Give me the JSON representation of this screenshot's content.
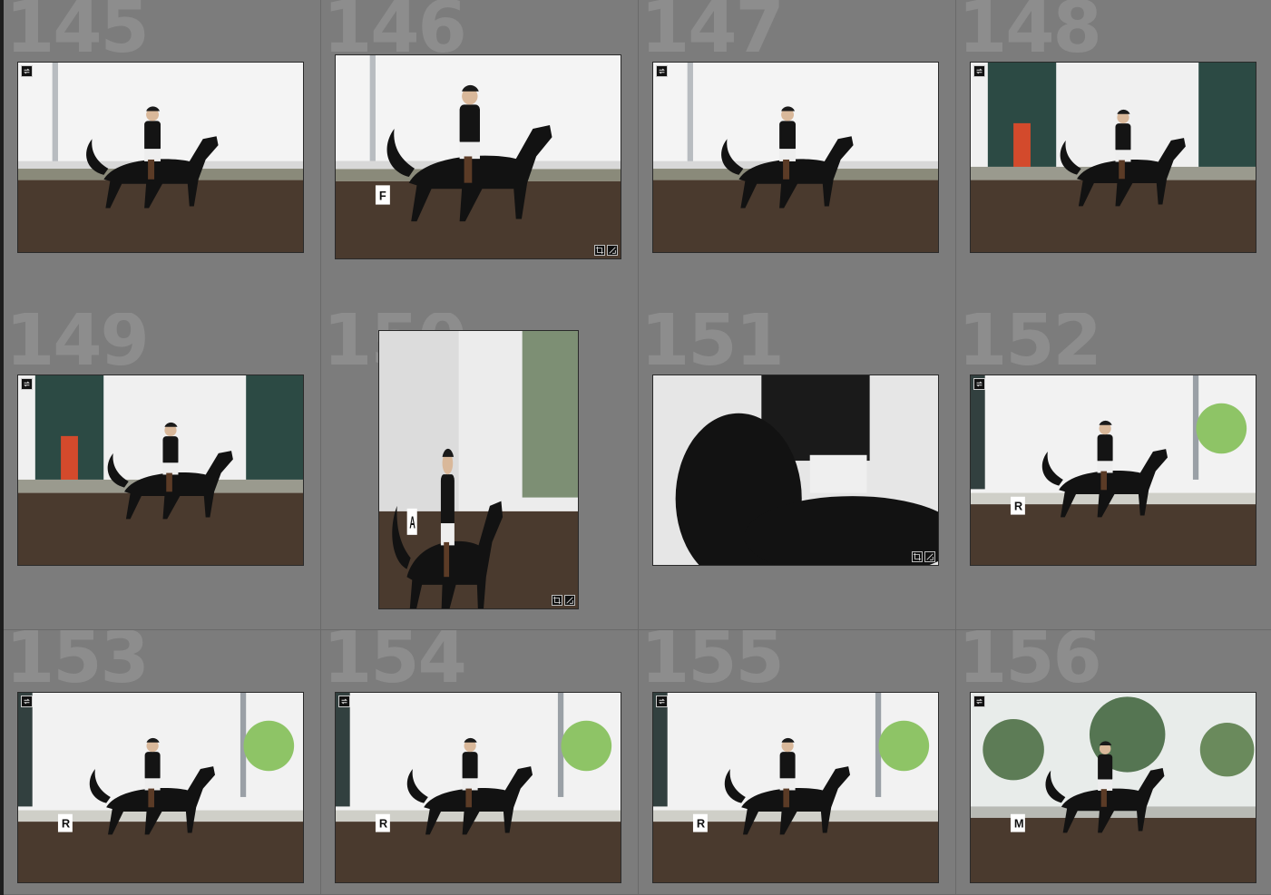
{
  "colors": {
    "grid_bg": "#7b7b7b",
    "cell_bg": "#7c7c7c",
    "cell_number": "#8d8d8d",
    "arena_dirt": "#4a3a2e",
    "horse": "#121212",
    "sky": "#f4f4f4"
  },
  "cells": [
    {
      "number": "145",
      "scene": "arena-white",
      "orientation": "landscape",
      "sync_badge": true,
      "edit_badges": false
    },
    {
      "number": "146",
      "scene": "arena-white-close",
      "orientation": "landscape",
      "sync_badge": false,
      "edit_badges": true
    },
    {
      "number": "147",
      "scene": "arena-white",
      "orientation": "landscape",
      "sync_badge": true,
      "edit_badges": false
    },
    {
      "number": "148",
      "scene": "barn-green",
      "orientation": "landscape",
      "sync_badge": true,
      "edit_badges": false
    },
    {
      "number": "149",
      "scene": "barn-green",
      "orientation": "landscape",
      "sync_badge": true,
      "edit_badges": false
    },
    {
      "number": "150",
      "scene": "portrait-trees",
      "orientation": "portrait",
      "sync_badge": false,
      "edit_badges": true
    },
    {
      "number": "151",
      "scene": "closeup",
      "orientation": "landscape",
      "sync_badge": false,
      "edit_badges": true
    },
    {
      "number": "152",
      "scene": "arena-tree",
      "orientation": "landscape",
      "sync_badge": true,
      "edit_badges": false
    },
    {
      "number": "153",
      "scene": "arena-tree",
      "orientation": "landscape",
      "sync_badge": true,
      "edit_badges": false
    },
    {
      "number": "154",
      "scene": "arena-tree",
      "orientation": "landscape",
      "sync_badge": true,
      "edit_badges": false
    },
    {
      "number": "155",
      "scene": "arena-tree",
      "orientation": "landscape",
      "sync_badge": true,
      "edit_badges": false
    },
    {
      "number": "156",
      "scene": "forest",
      "orientation": "landscape",
      "sync_badge": true,
      "edit_badges": false
    }
  ],
  "arena_letters": {
    "146": "F",
    "150": "A",
    "152": "R",
    "153": "R",
    "154": "R",
    "155": "R",
    "156": "M"
  },
  "icons": {
    "sync_badge": "sync-settings-icon",
    "crop_badge": "crop-icon",
    "adjust_badge": "develop-adjustments-icon"
  }
}
